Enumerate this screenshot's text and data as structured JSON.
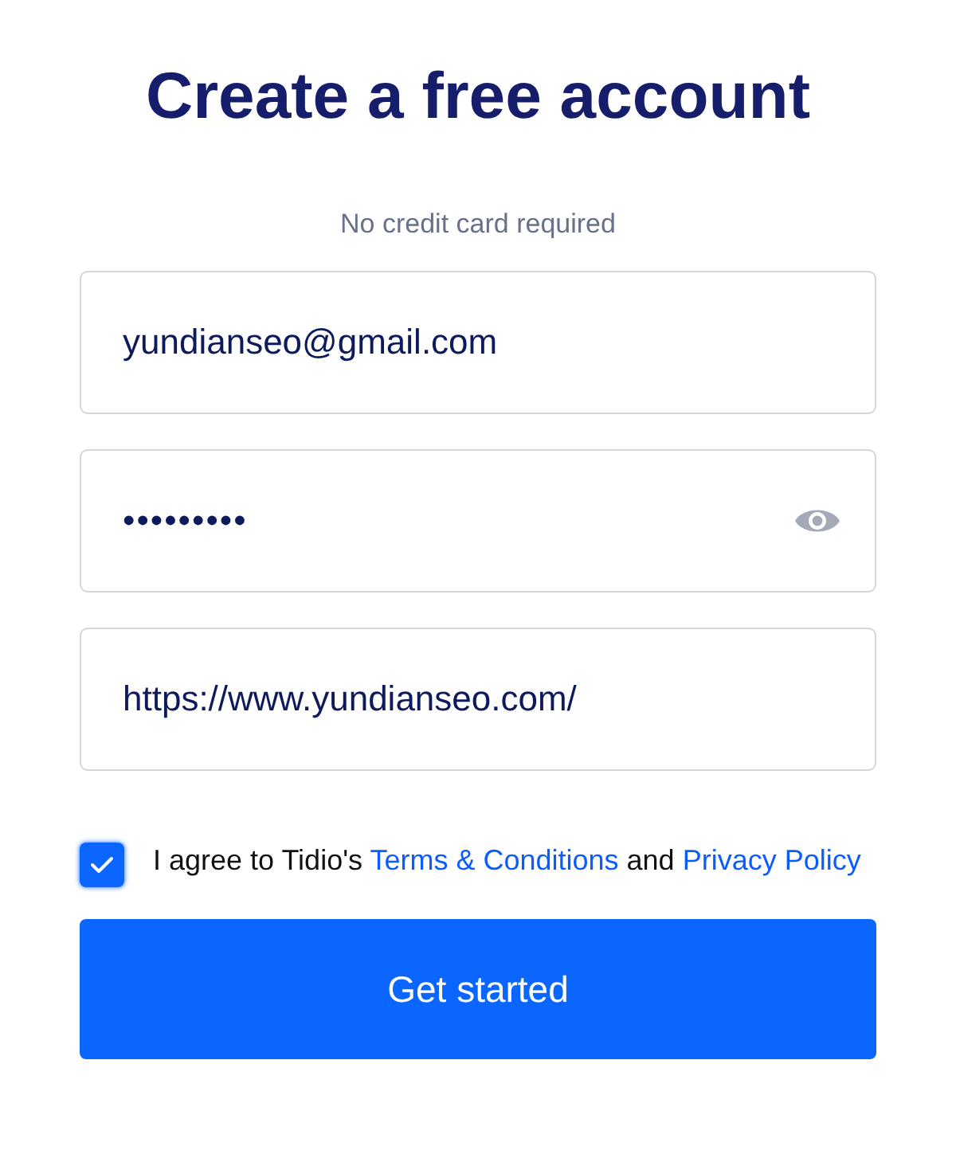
{
  "title": "Create a free account",
  "subtitle": "No credit card required",
  "fields": [
    {
      "kind": "text",
      "value": "yundianseo@gmail.com"
    },
    {
      "kind": "password",
      "value": "•••••••••"
    },
    {
      "kind": "text",
      "value": "https://www.yundianseo.com/"
    }
  ],
  "consent": {
    "checked": true,
    "before": "I agree to Tidio's",
    "terms_link": "Terms & Conditions",
    "middle": "and",
    "privacy_link": "Privacy Policy"
  },
  "submit": "Get started"
}
